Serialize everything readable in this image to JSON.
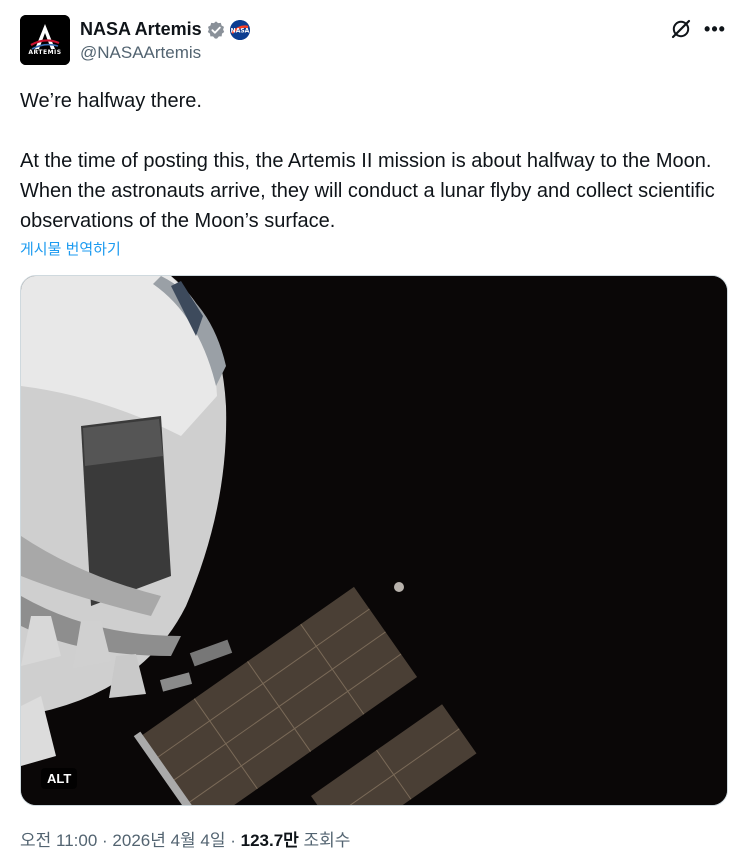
{
  "header": {
    "display_name": "NASA Artemis",
    "handle": "@NASAArtemis",
    "avatar_text": "ARTEMIS",
    "more_label": "•••"
  },
  "tweet": {
    "paragraph_1": "We’re halfway there.",
    "paragraph_2": "At the time of posting this, the Artemis II mission is about halfway to the Moon. When the astronauts arrive, they will conduct a lunar flyby and collect scientific observations of the Moon’s surface.",
    "translate_label": "게시물 번역하기"
  },
  "media": {
    "alt_label": "ALT"
  },
  "meta": {
    "time": "오전 11:00",
    "sep1": " · ",
    "date": "2026년 4월 4일",
    "sep2": " · ",
    "views_count": "123.7만",
    "views_label": " 조회수"
  },
  "colors": {
    "link": "#1d9bf0",
    "verified": "#1d9bf0",
    "secondary_text": "#536471",
    "primary_text": "#0f1419"
  },
  "icons": {
    "verified": "verified-badge-icon",
    "affiliation": "nasa-meatball-icon",
    "grok": "grok-icon",
    "more": "more-icon"
  }
}
